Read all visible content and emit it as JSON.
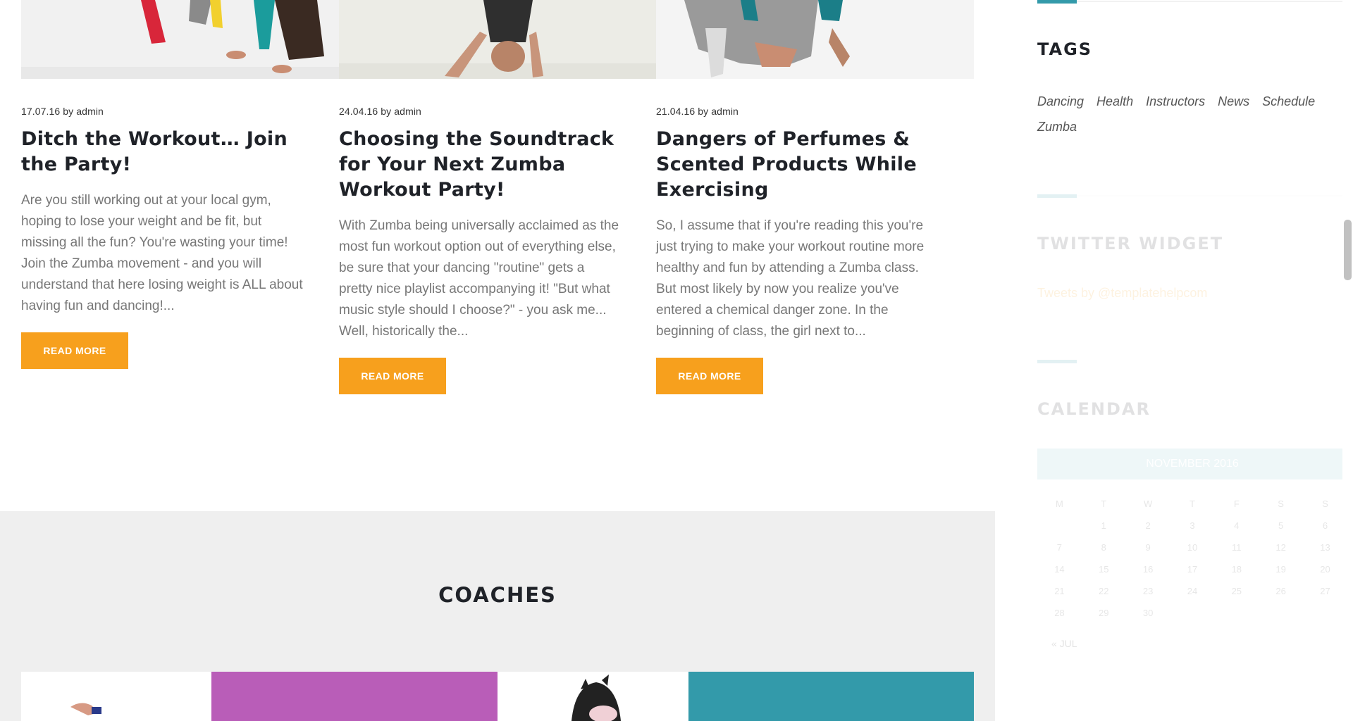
{
  "posts": [
    {
      "date": "17.07.16",
      "by": "by",
      "author": "admin",
      "title": "Ditch the Workout… Join the Party!",
      "excerpt": "Are you still working out at your local gym, hoping to lose your weight and be fit, but missing all the fun? You're wasting your time! Join the Zumba movement - and you will understand that here losing weight is ALL about having fun and dancing!...",
      "button": "READ MORE"
    },
    {
      "date": "24.04.16",
      "by": "by",
      "author": "admin",
      "title": "Choosing the Soundtrack for Your Next Zumba Workout Party!",
      "excerpt": "With Zumba being universally acclaimed as the most fun workout option out of everything else, be sure that your dancing \"routine\" gets a pretty nice playlist accompanying it! \"But what music style should I choose?\" - you ask me... Well, historically the...",
      "button": "READ MORE"
    },
    {
      "date": "21.04.16",
      "by": "by",
      "author": "admin",
      "title": "Dangers of Perfumes & Scented Products While Exercising",
      "excerpt": "So, I assume that if you're reading this you're just trying to make your workout routine more healthy and fun by attending a Zumba class. But most likely by now you realize you've entered a chemical danger zone. In the beginning of class, the girl next to...",
      "button": "READ MORE"
    }
  ],
  "coaches": {
    "title": "COACHES"
  },
  "sidebar": {
    "tags_title": "TAGS",
    "tags": [
      "Dancing",
      "Health",
      "Instructors",
      "News",
      "Schedule",
      "Zumba"
    ],
    "twitter_title": "TWITTER WIDGET",
    "twitter_link": "Tweets by @templatehelpcom",
    "calendar_title": "CALENDAR",
    "calendar_month": "NOVEMBER 2016",
    "calendar_days": [
      "M",
      "T",
      "W",
      "T",
      "F",
      "S",
      "S"
    ],
    "calendar_weeks": [
      [
        "",
        "1",
        "2",
        "3",
        "4",
        "5",
        "6"
      ],
      [
        "7",
        "8",
        "9",
        "10",
        "11",
        "12",
        "13"
      ],
      [
        "14",
        "15",
        "16",
        "17",
        "18",
        "19",
        "20"
      ],
      [
        "21",
        "22",
        "23",
        "24",
        "25",
        "26",
        "27"
      ],
      [
        "28",
        "29",
        "30",
        "",
        "",
        "",
        ""
      ]
    ],
    "calendar_prev": "« JUL"
  },
  "colors": {
    "accent_orange": "#f7a01d",
    "teal": "#339aaa",
    "purple": "#b95db8",
    "heading": "#1f2228",
    "body_text": "#777777"
  }
}
